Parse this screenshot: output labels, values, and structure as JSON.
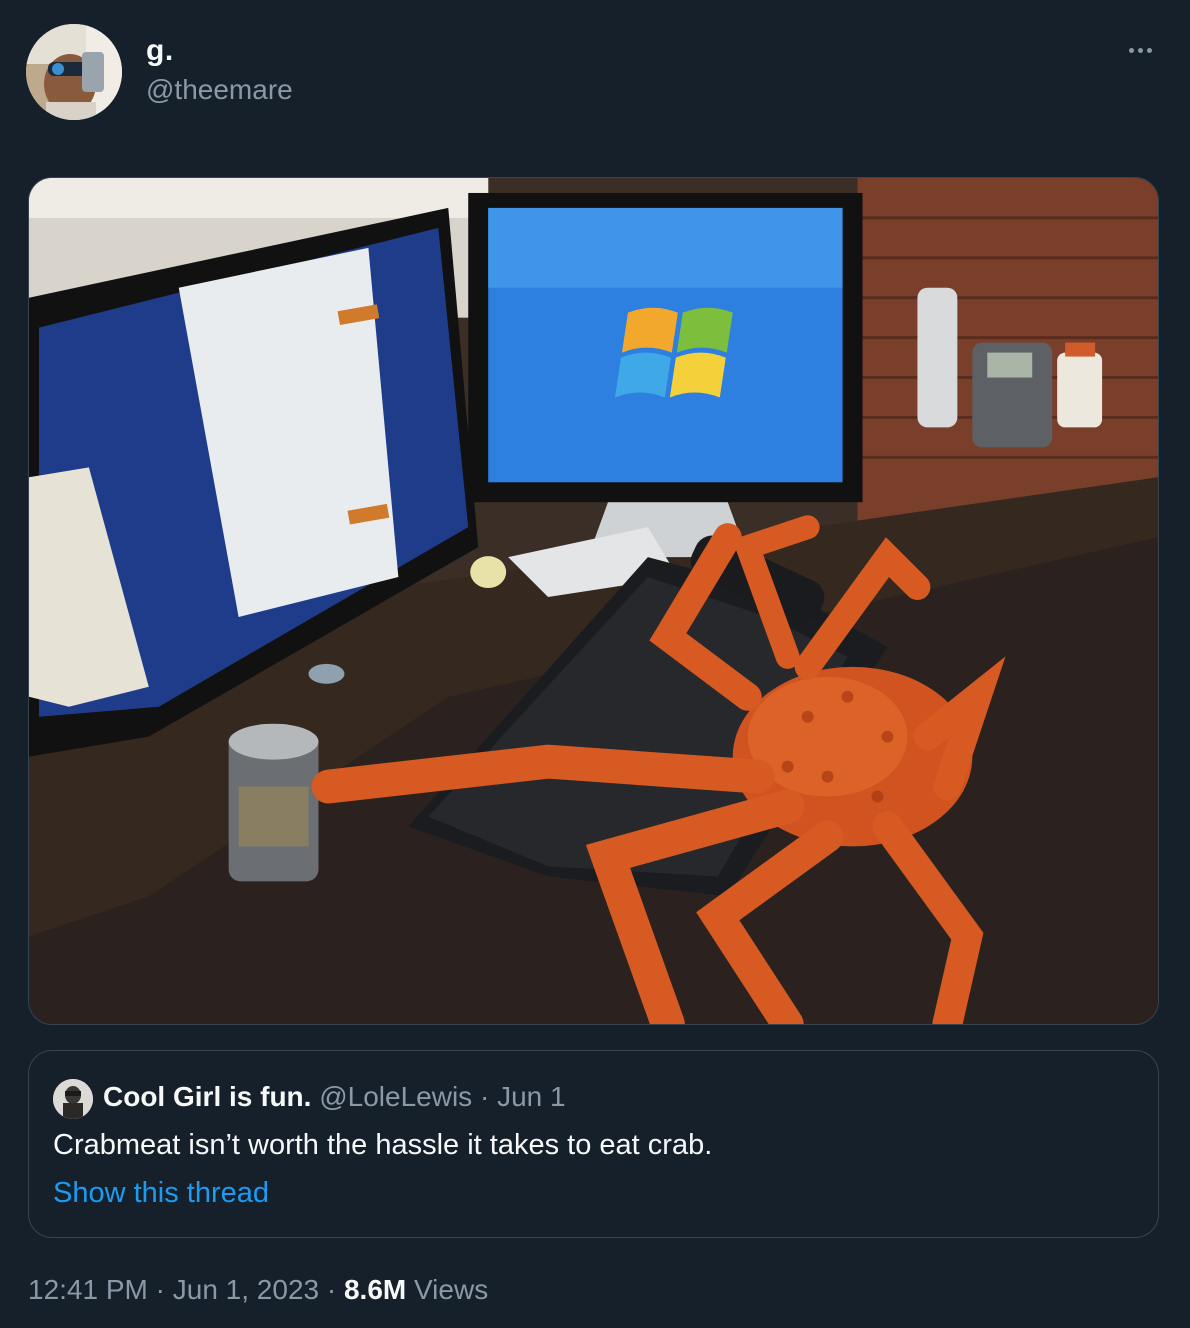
{
  "author": {
    "display_name": "g.",
    "handle": "@theemare"
  },
  "menu": {
    "icon": "more-horizontal-icon"
  },
  "media": {
    "description_icon": "photo"
  },
  "quoted_tweet": {
    "display_name": "Cool Girl is fun.",
    "handle": "@LoleLewis",
    "separator": "·",
    "date": "Jun 1",
    "text": "Crabmeat isn’t worth the hassle it takes to eat crab.",
    "show_thread": "Show this thread"
  },
  "footer": {
    "time": "12:41 PM",
    "sep1": "·",
    "date": "Jun 1, 2023",
    "sep2": "·",
    "views_count": "8.6M",
    "views_label": "Views"
  },
  "colors": {
    "background": "#15202b",
    "text": "#f7f9f9",
    "secondary": "#8b98a5",
    "link": "#1d9bf0",
    "border": "#38444d"
  }
}
